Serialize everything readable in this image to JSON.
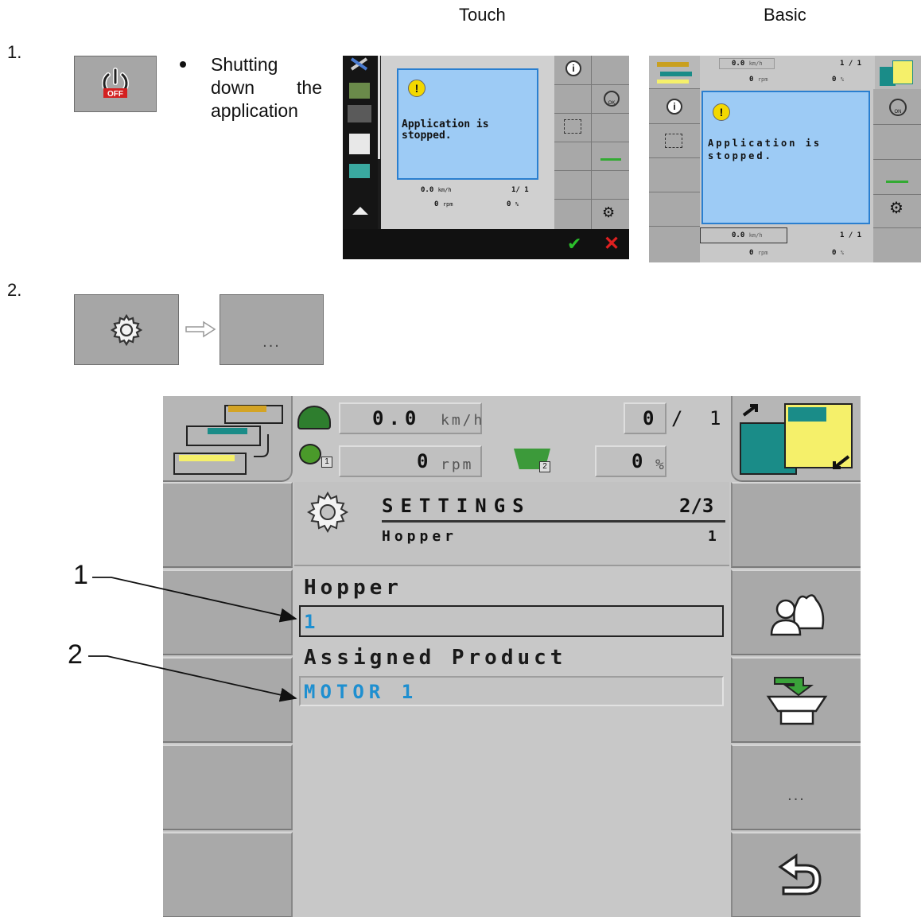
{
  "columns": {
    "touch": "Touch",
    "basic": "Basic"
  },
  "steps": [
    {
      "number": "1.",
      "bullet": "Shutting down the application",
      "button_badge": "OFF"
    },
    {
      "number": "2.",
      "second_button_label": "..."
    }
  ],
  "touch_screen": {
    "message": "Application is stopped.",
    "speed": "0.0",
    "speed_unit": "km/h",
    "count": "1/ 1",
    "rpm": "0",
    "rpm_unit": "rpm",
    "percent": "0",
    "percent_unit": "%",
    "ok_badge": "OK"
  },
  "basic_screen": {
    "message": "Application is stopped.",
    "speed": "0.0",
    "speed_unit": "km/h",
    "count": "1 / 1",
    "rpm": "0",
    "rpm_unit": "rpm",
    "percent": "0",
    "percent_unit": "%",
    "on_badge": "ON"
  },
  "settings_screen": {
    "speed": "0.0",
    "speed_unit": "km/h",
    "counter_left": "0",
    "counter_sep": "/",
    "counter_right": "1",
    "rpm": "0",
    "rpm_unit": "rpm",
    "hopper_badge": "2",
    "rpm_badge": "1",
    "percent": "0",
    "percent_unit": "%",
    "title": "SETTINGS",
    "page": "2/3",
    "subtitle": "Hopper",
    "subtitle_value": "1",
    "hopper_label": "Hopper",
    "hopper_value": "1",
    "product_label": "Assigned Product",
    "product_value": "MOTOR 1",
    "more_label": "..."
  },
  "callouts": [
    "1",
    "2"
  ],
  "colors": {
    "field_value": "#1e8fd0",
    "screen_blue": "#9dcbf5",
    "teal": "#1a8c88",
    "yellow": "#f5f06a",
    "green_ok": "#2bbf2b",
    "red_cancel": "#e02020"
  }
}
